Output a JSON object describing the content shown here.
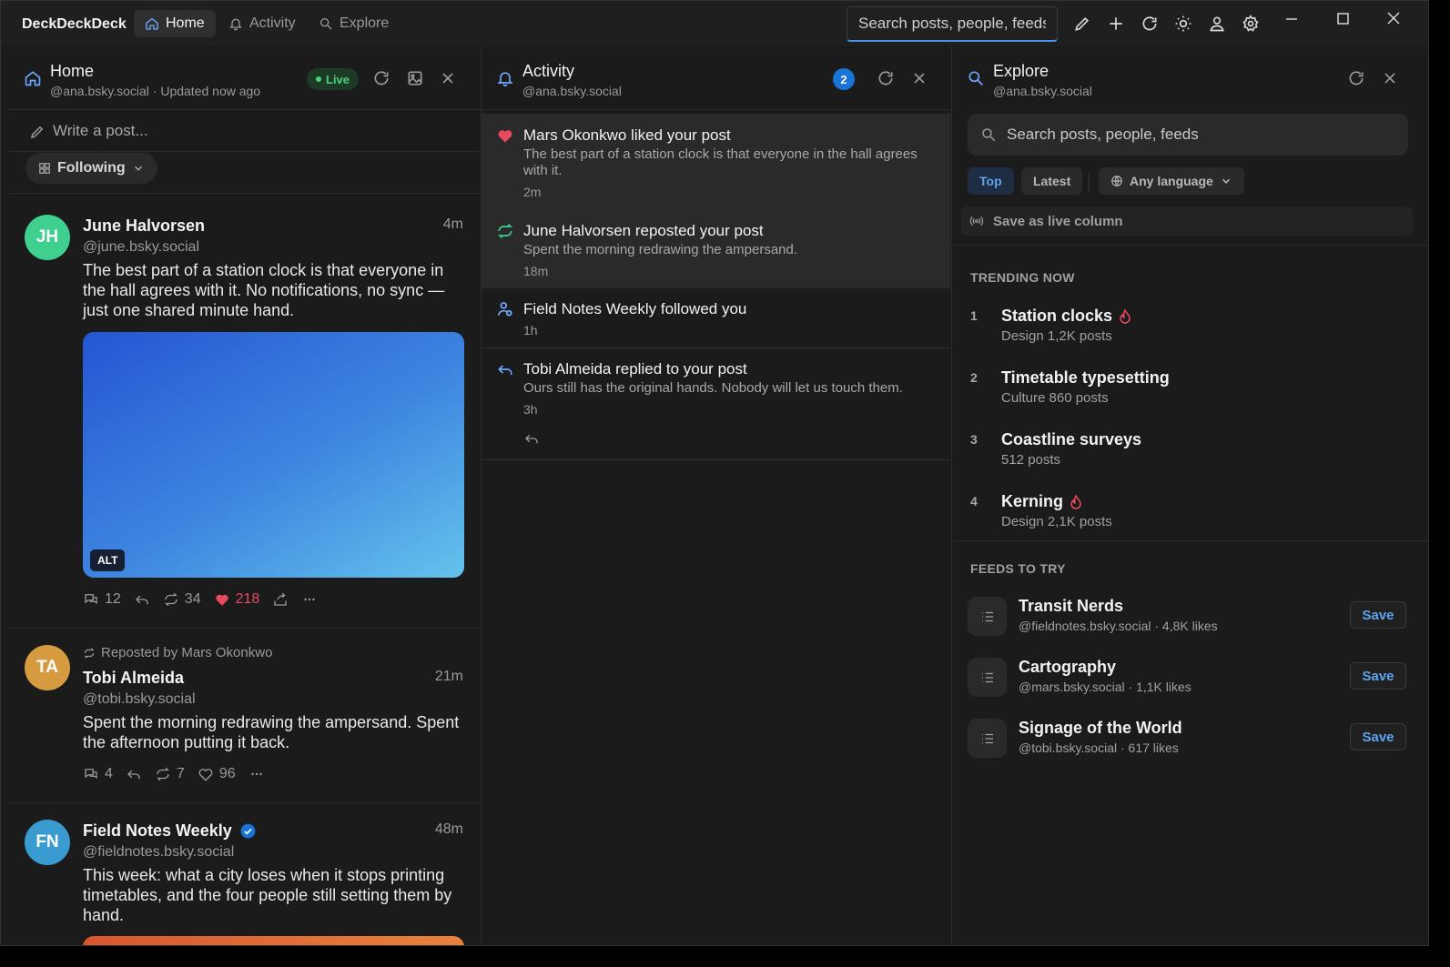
{
  "app": {
    "brand": "DeckDeckDeck",
    "nav": [
      {
        "label": "Home",
        "icon": "home-icon",
        "active": true
      },
      {
        "label": "Activity",
        "icon": "bell-icon",
        "active": false
      },
      {
        "label": "Explore",
        "icon": "search-icon",
        "active": false
      }
    ],
    "search_placeholder": "Search posts, people, feeds"
  },
  "home": {
    "title": "Home",
    "subtitle": "@ana.bsky.social · Updated now ago",
    "live_label": "Live",
    "compose_placeholder": "Write a post...",
    "feed_selector": "Following",
    "posts": [
      {
        "initials": "JH",
        "avatar_color": "#3fcf8e",
        "name": "June Halvorsen",
        "handle": "@june.bsky.social",
        "time": "4m",
        "text": "The best part of a station clock is that everyone in the hall agrees with it. No notifications, no sync — just one shared minute hand.",
        "alt_label": "ALT",
        "replies": "12",
        "reposts": "34",
        "likes": "218"
      },
      {
        "initials": "TA",
        "avatar_color": "#d59b3e",
        "reposted_by": "Reposted by Mars Okonkwo",
        "name": "Tobi Almeida",
        "handle": "@tobi.bsky.social",
        "time": "21m",
        "text": "Spent the morning redrawing the ampersand. Spent the afternoon putting it back.",
        "replies": "4",
        "reposts": "7",
        "likes": "96"
      },
      {
        "initials": "FN",
        "avatar_color": "#3a9bd1",
        "name": "Field Notes Weekly",
        "handle": "@fieldnotes.bsky.social",
        "time": "48m",
        "text": "This week: what a city loses when it stops printing timetables, and the four people still setting them by hand."
      }
    ]
  },
  "activity": {
    "title": "Activity",
    "subtitle": "@ana.bsky.social",
    "badge": "2",
    "items": [
      {
        "type": "like",
        "title": "Mars Okonkwo liked your post",
        "text": "The best part of a station clock is that everyone in the hall agrees with it.",
        "time": "2m"
      },
      {
        "type": "repost",
        "title": "June Halvorsen reposted your post",
        "text": "Spent the morning redrawing the ampersand.",
        "time": "18m"
      },
      {
        "type": "follow",
        "title": "Field Notes Weekly followed you",
        "text": "",
        "time": "1h"
      },
      {
        "type": "reply",
        "title": "Tobi Almeida replied to your post",
        "text": "Ours still has the original hands. Nobody will let us touch them.",
        "time": "3h"
      }
    ]
  },
  "explore": {
    "title": "Explore",
    "subtitle": "@ana.bsky.social",
    "search_placeholder": "Search posts, people, feeds",
    "tabs": [
      "Top",
      "Latest"
    ],
    "language": "Any language",
    "save_live": "Save as live column",
    "trending_heading": "TRENDING NOW",
    "trending": [
      {
        "rank": "1",
        "name": "Station clocks",
        "meta": "Design 1,2K posts",
        "hot": true
      },
      {
        "rank": "2",
        "name": "Timetable typesetting",
        "meta": "Culture  860 posts",
        "hot": false
      },
      {
        "rank": "3",
        "name": "Coastline surveys",
        "meta": "512 posts",
        "hot": false
      },
      {
        "rank": "4",
        "name": "Kerning",
        "meta": "Design 2,1K posts",
        "hot": true
      }
    ],
    "feeds_heading": "FEEDS TO TRY",
    "feeds": [
      {
        "name": "Transit Nerds",
        "meta": "@fieldnotes.bsky.social  · 4,8K likes",
        "save": "Save"
      },
      {
        "name": "Cartography",
        "meta": "@mars.bsky.social  · 1,1K likes",
        "save": "Save"
      },
      {
        "name": "Signage of the World",
        "meta": "@tobi.bsky.social  · 617 likes",
        "save": "Save"
      }
    ]
  },
  "colors": {
    "accent": "#4a90e2",
    "like": "#e8495f",
    "live": "#4cd17a",
    "repost": "#3fcf8e"
  }
}
